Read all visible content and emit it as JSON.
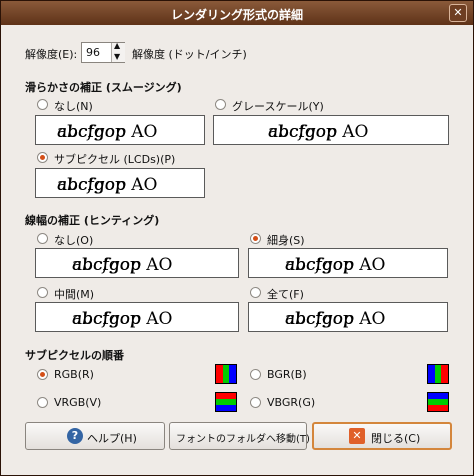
{
  "window": {
    "title": "レンダリング形式の詳細"
  },
  "resolution": {
    "label": "解像度(E):",
    "value": "96",
    "unit": "解像度 (ドット/インチ)"
  },
  "preview_text": {
    "roman": "abcfgop AO ",
    "italic": "abcfgop"
  },
  "smoothing": {
    "heading": "滑らかさの補正 (スムージング)",
    "options": [
      "なし(N)",
      "グレースケール(Y)",
      "サブピクセル (LCDs)(P)"
    ],
    "selected": "サブピクセル (LCDs)(P)"
  },
  "hinting": {
    "heading": "線幅の補正 (ヒンティング)",
    "options": [
      "なし(O)",
      "細身(S)",
      "中間(M)",
      "全て(F)"
    ],
    "selected": "細身(S)"
  },
  "subpixel_order": {
    "heading": "サブピクセルの順番",
    "options": [
      "RGB(R)",
      "BGR(B)",
      "VRGB(V)",
      "VBGR(G)"
    ],
    "selected": "RGB(R)"
  },
  "colors": {
    "red": "#ff0000",
    "green": "#00cc00",
    "blue": "#0000ff",
    "accent": "#d44f18"
  },
  "buttons": {
    "help": {
      "label": "ヘルプ(H)",
      "icon": "help-icon"
    },
    "goto_fonts": {
      "label": "フォントのフォルダへ移動(T)"
    },
    "close": {
      "label": "閉じる(C)",
      "icon": "close-x-icon"
    }
  }
}
